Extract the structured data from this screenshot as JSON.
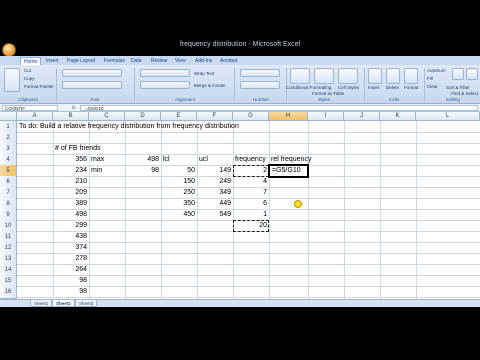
{
  "window": {
    "title": "frequency distribution - Microsoft Excel"
  },
  "ribbon": {
    "tabs": [
      "Home",
      "Insert",
      "Page Layout",
      "Formulas",
      "Data",
      "Review",
      "View",
      "Add-Ins",
      "Acrobat"
    ],
    "active_tab": "Home",
    "buttons": {
      "cut": "Cut",
      "copy": "Copy",
      "format_painter": "Format Painter",
      "wrap_text": "Wrap Text",
      "merge_center": "Merge & Center",
      "conditional_formatting": "Conditional Formatting",
      "format_as_table": "Format as Table",
      "cell_styles": "Cell Styles",
      "insert": "Insert",
      "delete": "Delete",
      "format": "Format",
      "autosum": "AutoSum",
      "fill": "Fill",
      "clear": "Clear",
      "sort_filter": "Sort & Filter",
      "find_select": "Find & Select"
    },
    "groups": [
      "Clipboard",
      "Font",
      "Alignment",
      "Number",
      "Styles",
      "Cells",
      "Editing"
    ]
  },
  "formula_bar": {
    "name_box": "COUNTIF",
    "fx": "fx",
    "formula": "=G5/G10"
  },
  "columns": [
    "A",
    "B",
    "C",
    "D",
    "E",
    "F",
    "G",
    "H",
    "I",
    "J",
    "K",
    "L"
  ],
  "rows": [
    "1",
    "2",
    "3",
    "4",
    "5",
    "6",
    "7",
    "8",
    "9",
    "10",
    "11",
    "12",
    "13",
    "14",
    "15",
    "16",
    "17"
  ],
  "cells": {
    "A1": "To do:  Build a relative frequency distribution from frequency distribution",
    "B3": "# of FB friends",
    "B4": "356",
    "C4": "max",
    "D4": "498",
    "E4": "lcl",
    "F4": "ucl",
    "G4": "frequency",
    "H4": "rel frequency",
    "B5": "234",
    "C5": "min",
    "D5": "98",
    "E5": "50",
    "F5": "149",
    "G5": "2",
    "H5": "=G5/G10",
    "B6": "210",
    "E6": "150",
    "F6": "249",
    "G6": "4",
    "B7": "209",
    "E7": "250",
    "F7": "349",
    "G7": "7",
    "B8": "389",
    "E8": "350",
    "F8": "449",
    "G8": "6",
    "B9": "498",
    "E9": "450",
    "F9": "549",
    "G9": "1",
    "B10": "299",
    "G10": "20",
    "B11": "438",
    "B12": "374",
    "B13": "278",
    "B14": "264",
    "B15": "98",
    "B16": "98"
  },
  "sheet_tabs": [
    "Sheet1",
    "Sheet2",
    "Sheet3"
  ],
  "active_sheet": "Sheet2",
  "colors": {
    "ribbon": "#c7d8ee",
    "header": "#dbe6f4",
    "selected_header": "#f1c15f",
    "gridline": "#d0d7e5"
  }
}
